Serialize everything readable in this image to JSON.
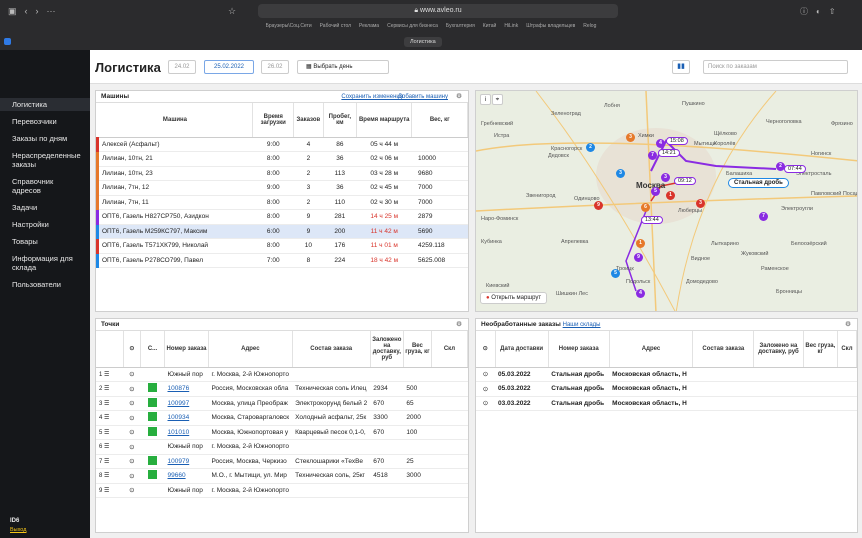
{
  "browser": {
    "url": "www.avleo.ru",
    "tab_title": "Логистика",
    "bookmarks": [
      "Браузеры\\Соц.Сети",
      "Рабочий стол",
      "Реклама",
      "Сервисы для бизнеса",
      "Бухгалтерия",
      "Китай",
      "HiLink",
      "Штрафы владельцев",
      "Relog"
    ]
  },
  "sidebar": {
    "items": [
      "Логистика",
      "Перевозчики",
      "Заказы по дням",
      "Нераспределенные заказы",
      "Справочник адресов",
      "Задачи",
      "Настройки",
      "Товары",
      "Информация для склада",
      "Пользователи"
    ],
    "footer_id": "ID6",
    "logout": "Выход"
  },
  "header": {
    "title": "Логистика",
    "date_prev": "24.02",
    "date_current": "25.02.2022",
    "date_next": "26.02",
    "choose_day": "Выбрать день",
    "search_placeholder": "Поиск по заказам"
  },
  "machines": {
    "title": "Машины",
    "save": "Сохранить изменения",
    "add": "Добавить машину",
    "columns": [
      "Машина",
      "Время загрузки",
      "Заказов",
      "Пробег, км",
      "Время маршрута",
      "Вес, кг"
    ],
    "rows": [
      [
        "Алексей (Асфальт)",
        "9:00",
        "4",
        "86",
        "05 ч 44 м",
        ""
      ],
      [
        "Лилиан, 10тн, 21",
        "8:00",
        "2",
        "36",
        "02 ч 06 м",
        "10000"
      ],
      [
        "Лилиан, 10тн, 23",
        "8:00",
        "2",
        "113",
        "03 ч 28 м",
        "9680"
      ],
      [
        "Лилиан, 7тн, 12",
        "9:00",
        "3",
        "36",
        "02 ч 45 м",
        "7000"
      ],
      [
        "Лилиан, 7тн, 11",
        "8:00",
        "2",
        "110",
        "02 ч 30 м",
        "7000"
      ],
      [
        "ОПТ6, Газель Н827СР750, Азидкон",
        "8:00",
        "9",
        "281",
        "14 ч 25 м",
        "2879"
      ],
      [
        "ОПТ6, Газель М259КС797, Максим",
        "6:00",
        "9",
        "200",
        "11 ч 42 м",
        "5690"
      ],
      [
        "ОПТ6, Газель Т571ХК799, Николай",
        "8:00",
        "10",
        "176",
        "11 ч 01 м",
        "4259.118"
      ],
      [
        "ОПТ6, Газель Р278СО799, Павел",
        "7:00",
        "8",
        "224",
        "18 ч 42 м",
        "5625.008"
      ]
    ],
    "colors": [
      "#d9342b",
      "#e6792a",
      "#e6792a",
      "#e6792a",
      "#e6792a",
      "#8a2be2",
      "#1e88e5",
      "#d9342b",
      "#1e88e5"
    ]
  },
  "points": {
    "title": "Точки",
    "columns": [
      "С...",
      "Номер заказа",
      "Адрес",
      "Состав заказа",
      "Заложено на доставку, руб",
      "Вес груза, кг",
      "Скл"
    ],
    "rows": [
      [
        "1",
        "",
        "Южный пор",
        "г. Москва, 2-й Южнопорто",
        "",
        "",
        ""
      ],
      [
        "2",
        "100876",
        "",
        "Россия, Московская обла",
        "Техническая соль Илец",
        "2934",
        "500"
      ],
      [
        "3",
        "100997",
        "",
        "Москва, улица Преображ",
        "Электрокорунд белый 2",
        "670",
        "65"
      ],
      [
        "4",
        "100934",
        "",
        "Москва, Староваргаловск",
        "Холодный асфальт, 25к",
        "3300",
        "2000"
      ],
      [
        "5",
        "101010",
        "",
        "Москва, Южнопортовая у",
        "Кварцевый песок 0,1-0,",
        "670",
        "100"
      ],
      [
        "6",
        "",
        "Южный пор",
        "г. Москва, 2-й Южнопорто",
        "",
        "",
        ""
      ],
      [
        "7",
        "100979",
        "",
        "Россия, Москва, Черкизо",
        "Стеклошарики «ТехВе",
        "670",
        "25"
      ],
      [
        "8",
        "99660",
        "",
        "М.О., г. Мытищи, ул. Мир",
        "Техническая соль, 25кг",
        "4518",
        "3000"
      ],
      [
        "9",
        "",
        "Южный пор",
        "г. Москва, 2-й Южнопорто",
        "",
        "",
        ""
      ]
    ]
  },
  "unprocessed": {
    "title": "Необработанные заказы",
    "stock": "Наши склады",
    "columns": [
      "Дата доставки",
      "Номер заказа",
      "Адрес",
      "Состав заказа",
      "Заложено на доставку, руб",
      "Вес груза, кг",
      "Скл"
    ],
    "rows": [
      [
        "05.03.2022",
        "Стальная дробь",
        "Московская область, Н"
      ],
      [
        "05.03.2022",
        "Стальная дробь",
        "Московская область, Н"
      ],
      [
        "03.03.2022",
        "Стальная дробь",
        "Московская область, Н"
      ]
    ]
  },
  "map": {
    "route_button": "Открыть маршрут",
    "callout": "Стальная дробь",
    "times": [
      "15:08",
      "14:21",
      "09:12",
      "07:44",
      "13:44"
    ],
    "labels": [
      "Зеленоград",
      "Лобня",
      "Пушкино",
      "Химки",
      "Мытищи",
      "Щёлково",
      "Королёв",
      "Москва",
      "Балашиха",
      "Электросталь",
      "Красногорск",
      "Одинцово",
      "Люберцы",
      "Жуковский",
      "Раменское",
      "Подольск",
      "Домодедово",
      "Троицк",
      "Апрелевка",
      "Кубинка",
      "Ногинск",
      "Истра",
      "Дедовск",
      "Киевский",
      "Шишкин Лес",
      "Лыткарино",
      "Бронницы",
      "Белоозёрский",
      "Электроугли",
      "Павловский Посад",
      "Черноголовка",
      "Фрязино",
      "Гребневский",
      "Звенигород",
      "Наро-Фоминск",
      "Видное"
    ]
  }
}
